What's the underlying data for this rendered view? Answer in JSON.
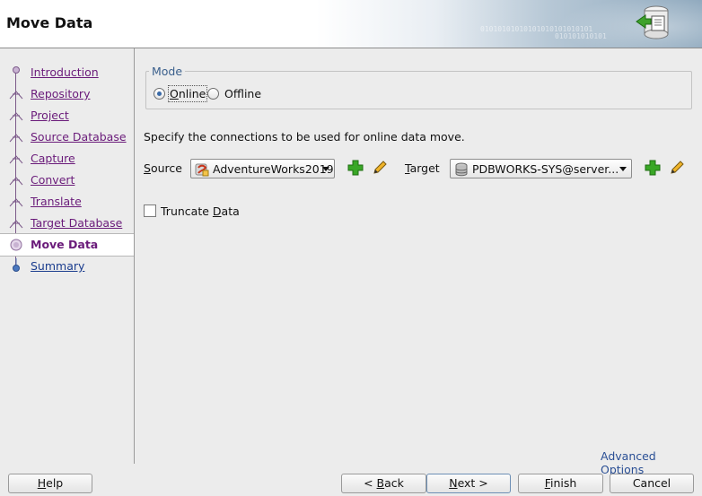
{
  "window": {
    "title": "Move Data",
    "banner_bits": [
      "01010101010101010101010101",
      "010101010101"
    ]
  },
  "nav": {
    "items": [
      {
        "label": "Introduction",
        "state": "done"
      },
      {
        "label": "Repository",
        "state": "done"
      },
      {
        "label": "Project",
        "state": "done"
      },
      {
        "label": "Source Database",
        "state": "done"
      },
      {
        "label": "Capture",
        "state": "done"
      },
      {
        "label": "Convert",
        "state": "done"
      },
      {
        "label": "Translate",
        "state": "done"
      },
      {
        "label": "Target Database",
        "state": "done"
      },
      {
        "label": "Move Data",
        "state": "current"
      },
      {
        "label": "Summary",
        "state": "future"
      }
    ]
  },
  "mode": {
    "legend": "Mode",
    "options": [
      {
        "label": "Online",
        "checked": true
      },
      {
        "label": "Offline",
        "checked": false
      }
    ]
  },
  "instructions": "Specify the connections to be used for online data move.",
  "source": {
    "label": "Source",
    "value": "AdventureWorks2019",
    "icon": "sqlserver-connection-icon"
  },
  "target": {
    "label": "Target",
    "value": "PDBWORKS-SYS@server...",
    "icon": "database-connection-icon"
  },
  "truncate": {
    "label": "Truncate Data",
    "checked": false
  },
  "advanced_link": "Advanced Options",
  "buttons": {
    "help": "Help",
    "back": "< Back",
    "next": "Next >",
    "finish": "Finish",
    "cancel": "Cancel"
  },
  "colors": {
    "visited_link": "#6a1b7a",
    "link": "#1a3c8e",
    "legend": "#3a5f8c",
    "add_icon": "#2e9c1f"
  }
}
